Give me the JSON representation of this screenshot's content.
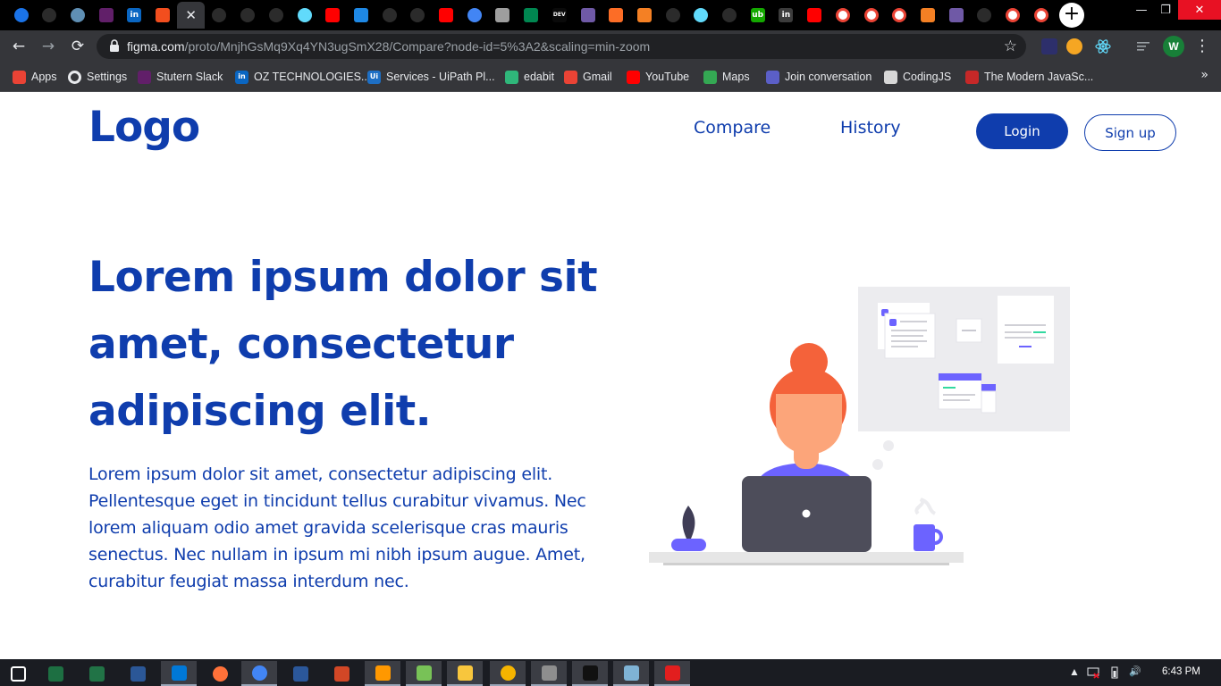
{
  "browser": {
    "new_tab_symbol": "+",
    "tab_close_symbol": "✕",
    "tabs": [
      {
        "icon": "loader-icon",
        "color": "#1a73e8"
      },
      {
        "icon": "github-icon",
        "color": "#2b2b2b"
      },
      {
        "icon": "power-icon",
        "color": "#5f8fb4"
      },
      {
        "icon": "slack-icon",
        "color": "#611f69"
      },
      {
        "icon": "linkedin-icon",
        "color": "#0a66c2"
      },
      {
        "icon": "figma-icon",
        "color": "#f24e1e"
      },
      {
        "icon": "figma-active-close-icon",
        "color": "#35363a"
      },
      {
        "icon": "github-icon",
        "color": "#2b2b2b"
      },
      {
        "icon": "github-icon",
        "color": "#2b2b2b"
      },
      {
        "icon": "github-icon",
        "color": "#2b2b2b"
      },
      {
        "icon": "react-icon",
        "color": "#61dafb"
      },
      {
        "icon": "youtube-icon",
        "color": "#ff0000"
      },
      {
        "icon": "p-app-icon",
        "color": "#1e88e5"
      },
      {
        "icon": "github-icon",
        "color": "#2b2b2b"
      },
      {
        "icon": "github-icon",
        "color": "#2b2b2b"
      },
      {
        "icon": "youtube-icon",
        "color": "#ff0000"
      },
      {
        "icon": "google-cloud-icon",
        "color": "#4285f4"
      },
      {
        "icon": "hexagon-icon",
        "color": "#9e9e9e"
      },
      {
        "icon": "flag-icon",
        "color": "#008751"
      },
      {
        "icon": "dev-icon",
        "color": "#0a0a0a"
      },
      {
        "icon": "hackerrank-icon",
        "color": "#6f59a6"
      },
      {
        "icon": "gitlab-icon",
        "color": "#fc6d26"
      },
      {
        "icon": "stackoverflow-icon",
        "color": "#f48024"
      },
      {
        "icon": "github-icon",
        "color": "#2b2b2b"
      },
      {
        "icon": "react-icon",
        "color": "#61dafb"
      },
      {
        "icon": "github-icon",
        "color": "#2b2b2b"
      },
      {
        "icon": "upwork-icon",
        "color": "#14a800"
      },
      {
        "icon": "linkedin-icon",
        "color": "#3c3c3c"
      },
      {
        "icon": "youtube-icon",
        "color": "#ff0000"
      },
      {
        "icon": "google-icon",
        "color": "#ffffff"
      },
      {
        "icon": "globe-icon",
        "color": "#ffffff"
      },
      {
        "icon": "globe-icon",
        "color": "#ffffff"
      },
      {
        "icon": "stackoverflow-icon",
        "color": "#f48024"
      },
      {
        "icon": "hackerrank-icon",
        "color": "#6f59a6"
      },
      {
        "icon": "github-icon",
        "color": "#2b2b2b"
      },
      {
        "icon": "google-icon",
        "color": "#ffffff"
      },
      {
        "icon": "google-icon",
        "color": "#ffffff"
      }
    ],
    "tab_labels": {
      "dev": "DEV",
      "linkedin": "in",
      "upwork": "ub"
    },
    "window_controls": {
      "minimize": "—",
      "restore": "❐",
      "close": "✕"
    },
    "nav": {
      "back": "←",
      "forward": "→",
      "reload": "⟳"
    },
    "url_host": "figma.com",
    "url_path": "/proto/MnjhGsMq9Xq4YN3ugSmX28/Compare?node-id=5%3A2&scaling=min-zoom",
    "star": "☆",
    "profile_initial": "W",
    "menu": "⋮",
    "bookmarks": [
      {
        "label": "Apps",
        "icon": "apps-grid-icon",
        "color": "#ea4335"
      },
      {
        "label": "Settings",
        "icon": "gear-icon",
        "color": "#e8eaed"
      },
      {
        "label": "Stutern Slack",
        "icon": "slack-icon",
        "color": "#611f69"
      },
      {
        "label": "OZ TECHNOLOGIES...",
        "icon": "linkedin-icon",
        "color": "#0a66c2"
      },
      {
        "label": "Services - UiPath Pl...",
        "icon": "uipath-icon",
        "color": "#1e6fc4"
      },
      {
        "label": "edabit",
        "icon": "edabit-icon",
        "color": "#2fb77a"
      },
      {
        "label": "Gmail",
        "icon": "gmail-icon",
        "color": "#ea4335"
      },
      {
        "label": "YouTube",
        "icon": "youtube-icon",
        "color": "#ff0000"
      },
      {
        "label": "Maps",
        "icon": "maps-icon",
        "color": "#34a853"
      },
      {
        "label": "Join conversation",
        "icon": "teams-icon",
        "color": "#5b5fc7"
      },
      {
        "label": "CodingJS",
        "icon": "codingjs-icon",
        "color": "#d7d7d7"
      },
      {
        "label": "The Modern JavaSc...",
        "icon": "modern-js-icon",
        "color": "#c62828"
      }
    ],
    "bookmarks_more": "»",
    "bookmark_glyphs": {
      "linkedin": "in",
      "uipath": "Ui"
    }
  },
  "site": {
    "logo": "Logo",
    "nav": {
      "compare": "Compare",
      "history": "History"
    },
    "login": "Login",
    "signup": "Sign up",
    "hero_title": "Lorem ipsum dolor sit amet, consectetur adipiscing elit.",
    "hero_text": "Lorem ipsum dolor sit amet, consectetur adipiscing elit. Pellentesque eget in tincidunt tellus curabitur vivamus. Nec lorem aliquam odio amet gravida scelerisque cras mauris senectus. Nec nullam in ipsum mi nibh ipsum augue. Amet, curabitur feugiat massa interdum nec.",
    "colors": {
      "brand": "#0f3dad",
      "hair": "#f4623a",
      "skin": "#fca57a",
      "shirt": "#6c63ff",
      "laptop": "#4d4d5a",
      "board": "#ececef",
      "desk": "#e6e6e6"
    }
  },
  "taskbar": {
    "apps": [
      {
        "icon": "windows-start-icon",
        "color": "#ffffff"
      },
      {
        "icon": "excel-green-icon",
        "color": "#1d6f42"
      },
      {
        "icon": "excel-icon",
        "color": "#217346"
      },
      {
        "icon": "visio-icon",
        "color": "#2b5797"
      },
      {
        "icon": "vscode-icon",
        "color": "#0078d7"
      },
      {
        "icon": "firefox-icon",
        "color": "#ff7139"
      },
      {
        "icon": "chrome-icon",
        "color": "#4285f4"
      },
      {
        "icon": "word-icon",
        "color": "#2b579a"
      },
      {
        "icon": "powerpoint-icon",
        "color": "#d24726"
      },
      {
        "icon": "sublime-icon",
        "color": "#ff9800"
      },
      {
        "icon": "android-icon",
        "color": "#78c257"
      },
      {
        "icon": "file-explorer-icon",
        "color": "#f8c63d"
      },
      {
        "icon": "chrome-canary-icon",
        "color": "#f5b400"
      },
      {
        "icon": "git-icon",
        "color": "#8e8e8e"
      },
      {
        "icon": "cmd-icon",
        "color": "#111111"
      },
      {
        "icon": "notepad-icon",
        "color": "#7fb3d5"
      },
      {
        "icon": "acrobat-icon",
        "color": "#e21e1e"
      }
    ],
    "tray": {
      "chevron": "▲",
      "volume": "🔊"
    },
    "time": "6:43 PM"
  }
}
